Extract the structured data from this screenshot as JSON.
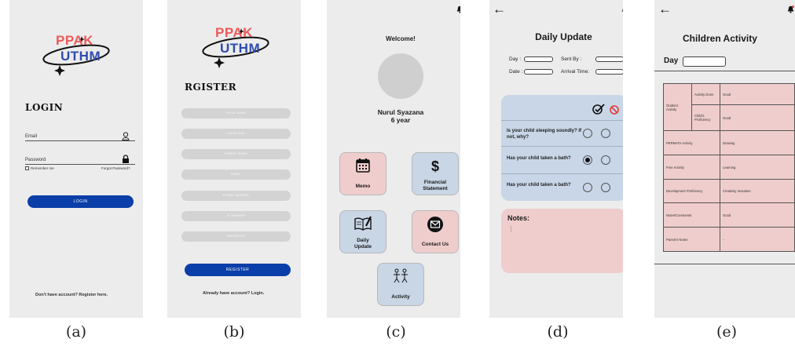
{
  "brand": {
    "top": "PPAK",
    "bottom": "UTHM"
  },
  "login": {
    "title": "LOGIN",
    "email_label": "Email",
    "password_label": "Password",
    "remember_label": "Remember me",
    "forgot_label": "Forgot Password?",
    "login_button": "LOGIN",
    "register_prompt": "Don't have account? Register here."
  },
  "register": {
    "title": "RGISTER",
    "fields": [
      "CHILD NAME",
      "CHILD AGE",
      "PARENT NAME",
      "EMAIL",
      "PHONE NUMBER",
      "IC NUMBER",
      "PASSWORD"
    ],
    "register_button": "REGISTER",
    "login_prompt": "Already have account? Login."
  },
  "home": {
    "welcome": "Welcome!",
    "name": "Nurul Syazana",
    "age": "6 year",
    "tiles": {
      "memo": "Memo",
      "financial_1": "Financial",
      "financial_2": "Statement",
      "daily_1": "Daily",
      "daily_2": "Update",
      "contact": "Contact Us",
      "activity": "Activity"
    }
  },
  "daily_update": {
    "title": "Daily Update",
    "day_label": "Day :",
    "sent_by_label": "Sent By  :",
    "date_label": "Date :",
    "arrival_label": "Arrival Time:",
    "questions": [
      {
        "text": "Is your child sleeping soundly? If not, why?",
        "selected": "none"
      },
      {
        "text": "Has your child taken a bath?",
        "selected": "yes"
      },
      {
        "text": "Has your child taken a bath?",
        "selected": "none"
      }
    ],
    "notes_label": "Notes:"
  },
  "children_activity": {
    "title": "Children Activity",
    "day_label": "Day",
    "rows": [
      {
        "group": "Outdoor Activity",
        "label": "Activity Done",
        "value": "Good"
      },
      {
        "group": "",
        "label": "Child's Proficiency",
        "value": "Good"
      },
      {
        "label": "PERMATA Activity",
        "value": "Drawing"
      },
      {
        "label": "Free Activity",
        "value": "Learning"
      },
      {
        "label": "Development Proficiency",
        "value": "Creativity Inovation"
      },
      {
        "label": "Notes/Comments",
        "value": "Good"
      },
      {
        "label": "Parent's Notes",
        "value": "-"
      }
    ]
  },
  "figure_labels": [
    "(a)",
    "(b)",
    "(c)",
    "(d)",
    "(e)"
  ],
  "colors": {
    "brand_red": "#ee5a5a",
    "brand_blue": "#2f4bb0",
    "primary_button": "#0a3ea8",
    "tile_pink": "#f0cdcd",
    "tile_blue": "#c8d6e6",
    "screen_bg": "#ececec"
  },
  "icons": [
    "user-icon",
    "lock-icon",
    "bell-icon",
    "back-arrow-icon",
    "calendar-icon",
    "dollar-icon",
    "book-pen-icon",
    "mail-icon",
    "kids-icon",
    "check-icon",
    "no-icon"
  ]
}
